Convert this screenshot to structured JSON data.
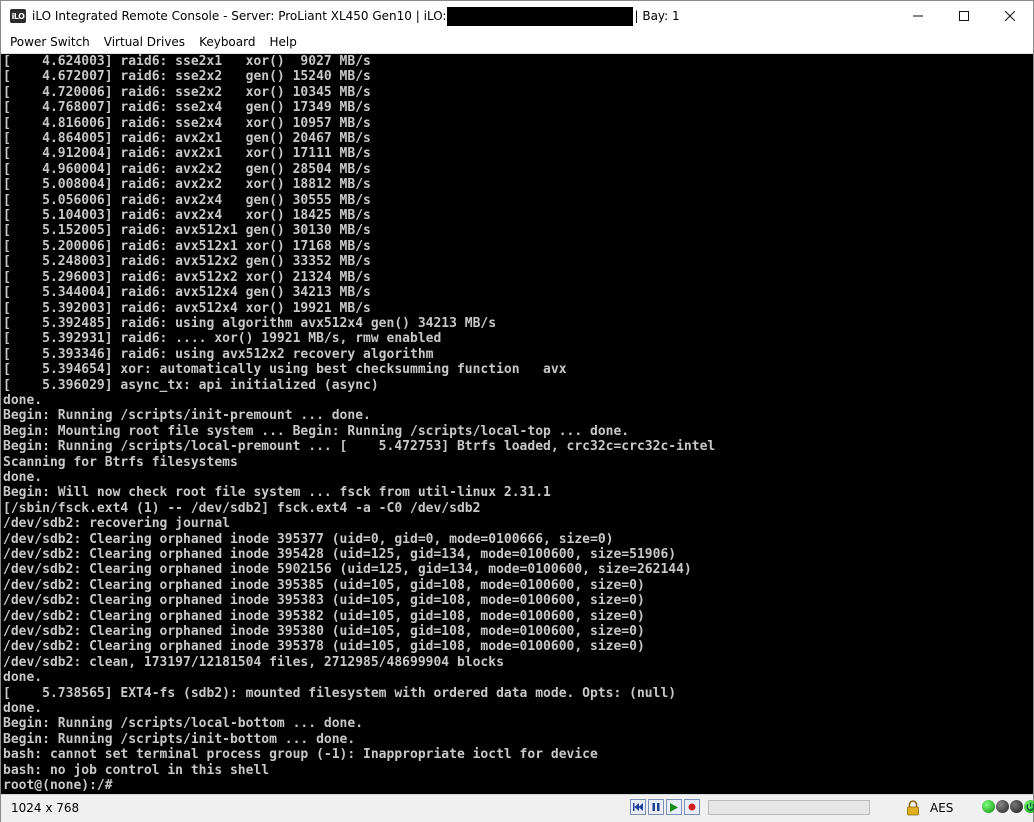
{
  "window": {
    "title_prefix": "iLO Integrated Remote Console - Server: ProLiant XL450 Gen10 | iLO:",
    "title_suffix": "| Bay: 1",
    "app_icon_text": "iLO",
    "controls": {
      "minimize": "—",
      "maximize": "☐",
      "close": "✕"
    }
  },
  "menu": {
    "items": [
      "Power Switch",
      "Virtual Drives",
      "Keyboard",
      "Help"
    ]
  },
  "console": {
    "lines": [
      "[    4.624003] raid6: sse2x1   xor()  9027 MB/s",
      "[    4.672007] raid6: sse2x2   gen() 15240 MB/s",
      "[    4.720006] raid6: sse2x2   xor() 10345 MB/s",
      "[    4.768007] raid6: sse2x4   gen() 17349 MB/s",
      "[    4.816006] raid6: sse2x4   xor() 10957 MB/s",
      "[    4.864005] raid6: avx2x1   gen() 20467 MB/s",
      "[    4.912004] raid6: avx2x1   xor() 17111 MB/s",
      "[    4.960004] raid6: avx2x2   gen() 28504 MB/s",
      "[    5.008004] raid6: avx2x2   xor() 18812 MB/s",
      "[    5.056006] raid6: avx2x4   gen() 30555 MB/s",
      "[    5.104003] raid6: avx2x4   xor() 18425 MB/s",
      "[    5.152005] raid6: avx512x1 gen() 30130 MB/s",
      "[    5.200006] raid6: avx512x1 xor() 17168 MB/s",
      "[    5.248003] raid6: avx512x2 gen() 33352 MB/s",
      "[    5.296003] raid6: avx512x2 xor() 21324 MB/s",
      "[    5.344004] raid6: avx512x4 gen() 34213 MB/s",
      "[    5.392003] raid6: avx512x4 xor() 19921 MB/s",
      "[    5.392485] raid6: using algorithm avx512x4 gen() 34213 MB/s",
      "[    5.392931] raid6: .... xor() 19921 MB/s, rmw enabled",
      "[    5.393346] raid6: using avx512x2 recovery algorithm",
      "[    5.394654] xor: automatically using best checksumming function   avx",
      "[    5.396029] async_tx: api initialized (async)",
      "done.",
      "Begin: Running /scripts/init-premount ... done.",
      "Begin: Mounting root file system ... Begin: Running /scripts/local-top ... done.",
      "Begin: Running /scripts/local-premount ... [    5.472753] Btrfs loaded, crc32c=crc32c-intel",
      "Scanning for Btrfs filesystems",
      "done.",
      "Begin: Will now check root file system ... fsck from util-linux 2.31.1",
      "[/sbin/fsck.ext4 (1) -- /dev/sdb2] fsck.ext4 -a -C0 /dev/sdb2",
      "/dev/sdb2: recovering journal",
      "/dev/sdb2: Clearing orphaned inode 395377 (uid=0, gid=0, mode=0100666, size=0)",
      "/dev/sdb2: Clearing orphaned inode 395428 (uid=125, gid=134, mode=0100600, size=51906)",
      "/dev/sdb2: Clearing orphaned inode 5902156 (uid=125, gid=134, mode=0100600, size=262144)",
      "/dev/sdb2: Clearing orphaned inode 395385 (uid=105, gid=108, mode=0100600, size=0)",
      "/dev/sdb2: Clearing orphaned inode 395383 (uid=105, gid=108, mode=0100600, size=0)",
      "/dev/sdb2: Clearing orphaned inode 395382 (uid=105, gid=108, mode=0100600, size=0)",
      "/dev/sdb2: Clearing orphaned inode 395380 (uid=105, gid=108, mode=0100600, size=0)",
      "/dev/sdb2: Clearing orphaned inode 395378 (uid=105, gid=108, mode=0100600, size=0)",
      "/dev/sdb2: clean, 173197/12181504 files, 2712985/48699904 blocks",
      "done.",
      "[    5.738565] EXT4-fs (sdb2): mounted filesystem with ordered data mode. Opts: (null)",
      "done.",
      "Begin: Running /scripts/local-bottom ... done.",
      "Begin: Running /scripts/init-bottom ... done.",
      "bash: cannot set terminal process group (-1): Inappropriate ioctl for device",
      "bash: no job control in this shell",
      "root@(none):/#"
    ]
  },
  "status": {
    "resolution": "1024 x 768",
    "encryption": "AES",
    "playback_icons": [
      "skip-back-icon",
      "pause-icon",
      "play-icon",
      "record-icon"
    ]
  }
}
